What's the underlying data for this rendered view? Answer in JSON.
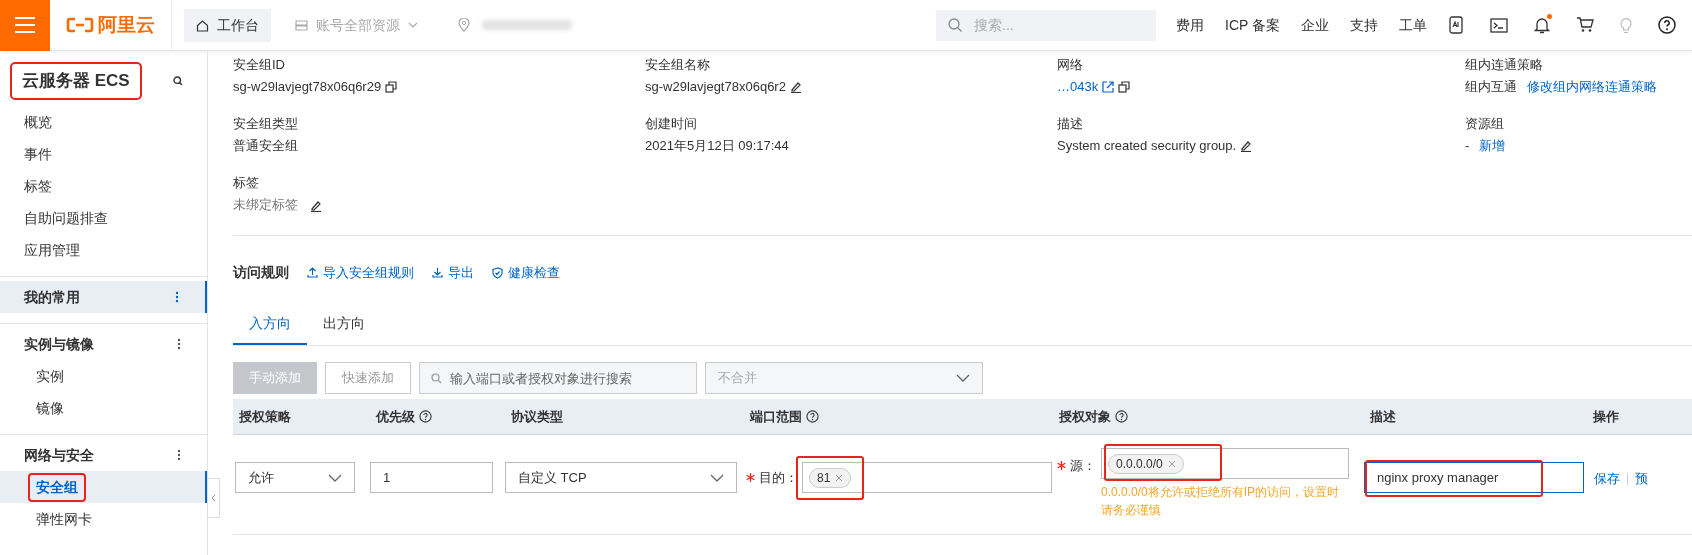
{
  "topbar": {
    "logo": "阿里云",
    "workbench": "工作台",
    "resources": "账号全部资源",
    "search": {
      "placeholder": "搜索..."
    },
    "links": [
      "费用",
      "ICP 备案",
      "企业",
      "支持",
      "工单"
    ],
    "notification": true
  },
  "sidebar": {
    "title": "云服务器 ECS",
    "title_highlighted": true,
    "items": [
      {
        "label": "概览",
        "kind": "item"
      },
      {
        "label": "事件",
        "kind": "item"
      },
      {
        "label": "标签",
        "kind": "item"
      },
      {
        "label": "自助问题排查",
        "kind": "item"
      },
      {
        "label": "应用管理",
        "kind": "item"
      }
    ],
    "groups": [
      {
        "label": "我的常用",
        "selected": true
      },
      {
        "label": "实例与镜像",
        "selected": false,
        "children": [
          {
            "label": "实例",
            "selected": false,
            "highlighted": false
          },
          {
            "label": "镜像",
            "selected": false,
            "highlighted": false
          }
        ]
      },
      {
        "label": "网络与安全",
        "selected": false,
        "children": [
          {
            "label": "安全组",
            "selected": true,
            "highlighted": true
          },
          {
            "label": "弹性网卡",
            "selected": false,
            "highlighted": false
          }
        ]
      }
    ]
  },
  "details": [
    {
      "label": "安全组ID",
      "value": "sg-w29lavjegt78x06q6r29",
      "kind": "copy"
    },
    {
      "label": "安全组名称",
      "value": "sg-w29lavjegt78x06q6r2",
      "kind": "edit"
    },
    {
      "label": "网络",
      "value": "…043k",
      "kind": "link"
    },
    {
      "label": "组内连通策略",
      "value": "组内互通",
      "action": "修改组内网络连通策略",
      "kind": "action"
    },
    {
      "label": "安全组类型",
      "value": "普通安全组",
      "kind": "plain"
    },
    {
      "label": "创建时间",
      "value": "2021年5月12日 09:17:44",
      "kind": "plain"
    },
    {
      "label": "描述",
      "value": "System created security group.",
      "kind": "edit"
    },
    {
      "label": "资源组",
      "value": "-",
      "action": "新增",
      "kind": "action"
    },
    {
      "label": "标签",
      "value": "未绑定标签",
      "kind": "edit_muted"
    }
  ],
  "rules": {
    "title": "访问规则",
    "actions": [
      "导入安全组规则",
      "导出",
      "健康检查"
    ],
    "tabs": [
      {
        "label": "入方向",
        "selected": true
      },
      {
        "label": "出方向",
        "selected": false
      }
    ],
    "toolbar": {
      "add": "手动添加",
      "add_disabled": true,
      "quick_add": "快速添加",
      "search_placeholder": "输入端口或者授权对象进行搜索",
      "merge": "不合并"
    },
    "columns": [
      {
        "label": "授权策略",
        "help": false
      },
      {
        "label": "优先级",
        "help": true
      },
      {
        "label": "协议类型",
        "help": false
      },
      {
        "label": "端口范围",
        "help": true
      },
      {
        "label": "授权对象",
        "help": true
      },
      {
        "label": "描述",
        "help": false
      },
      {
        "label": "操作",
        "help": false
      }
    ],
    "row": {
      "policy": "允许",
      "priority": "1",
      "protocol": "自定义 TCP",
      "port_required": true,
      "port_label": "目的：",
      "port_tag": "81",
      "port_highlighted": true,
      "source_required": true,
      "source_label": "源：",
      "source_tag": "0.0.0.0/0",
      "source_highlighted": true,
      "warning": "0.0.0.0/0将允许或拒绝所有IP的访问，设置时请务必谨慎",
      "description": "nginx proxy manager",
      "description_highlighted": true,
      "save": "保存",
      "next_action": "预"
    }
  }
}
